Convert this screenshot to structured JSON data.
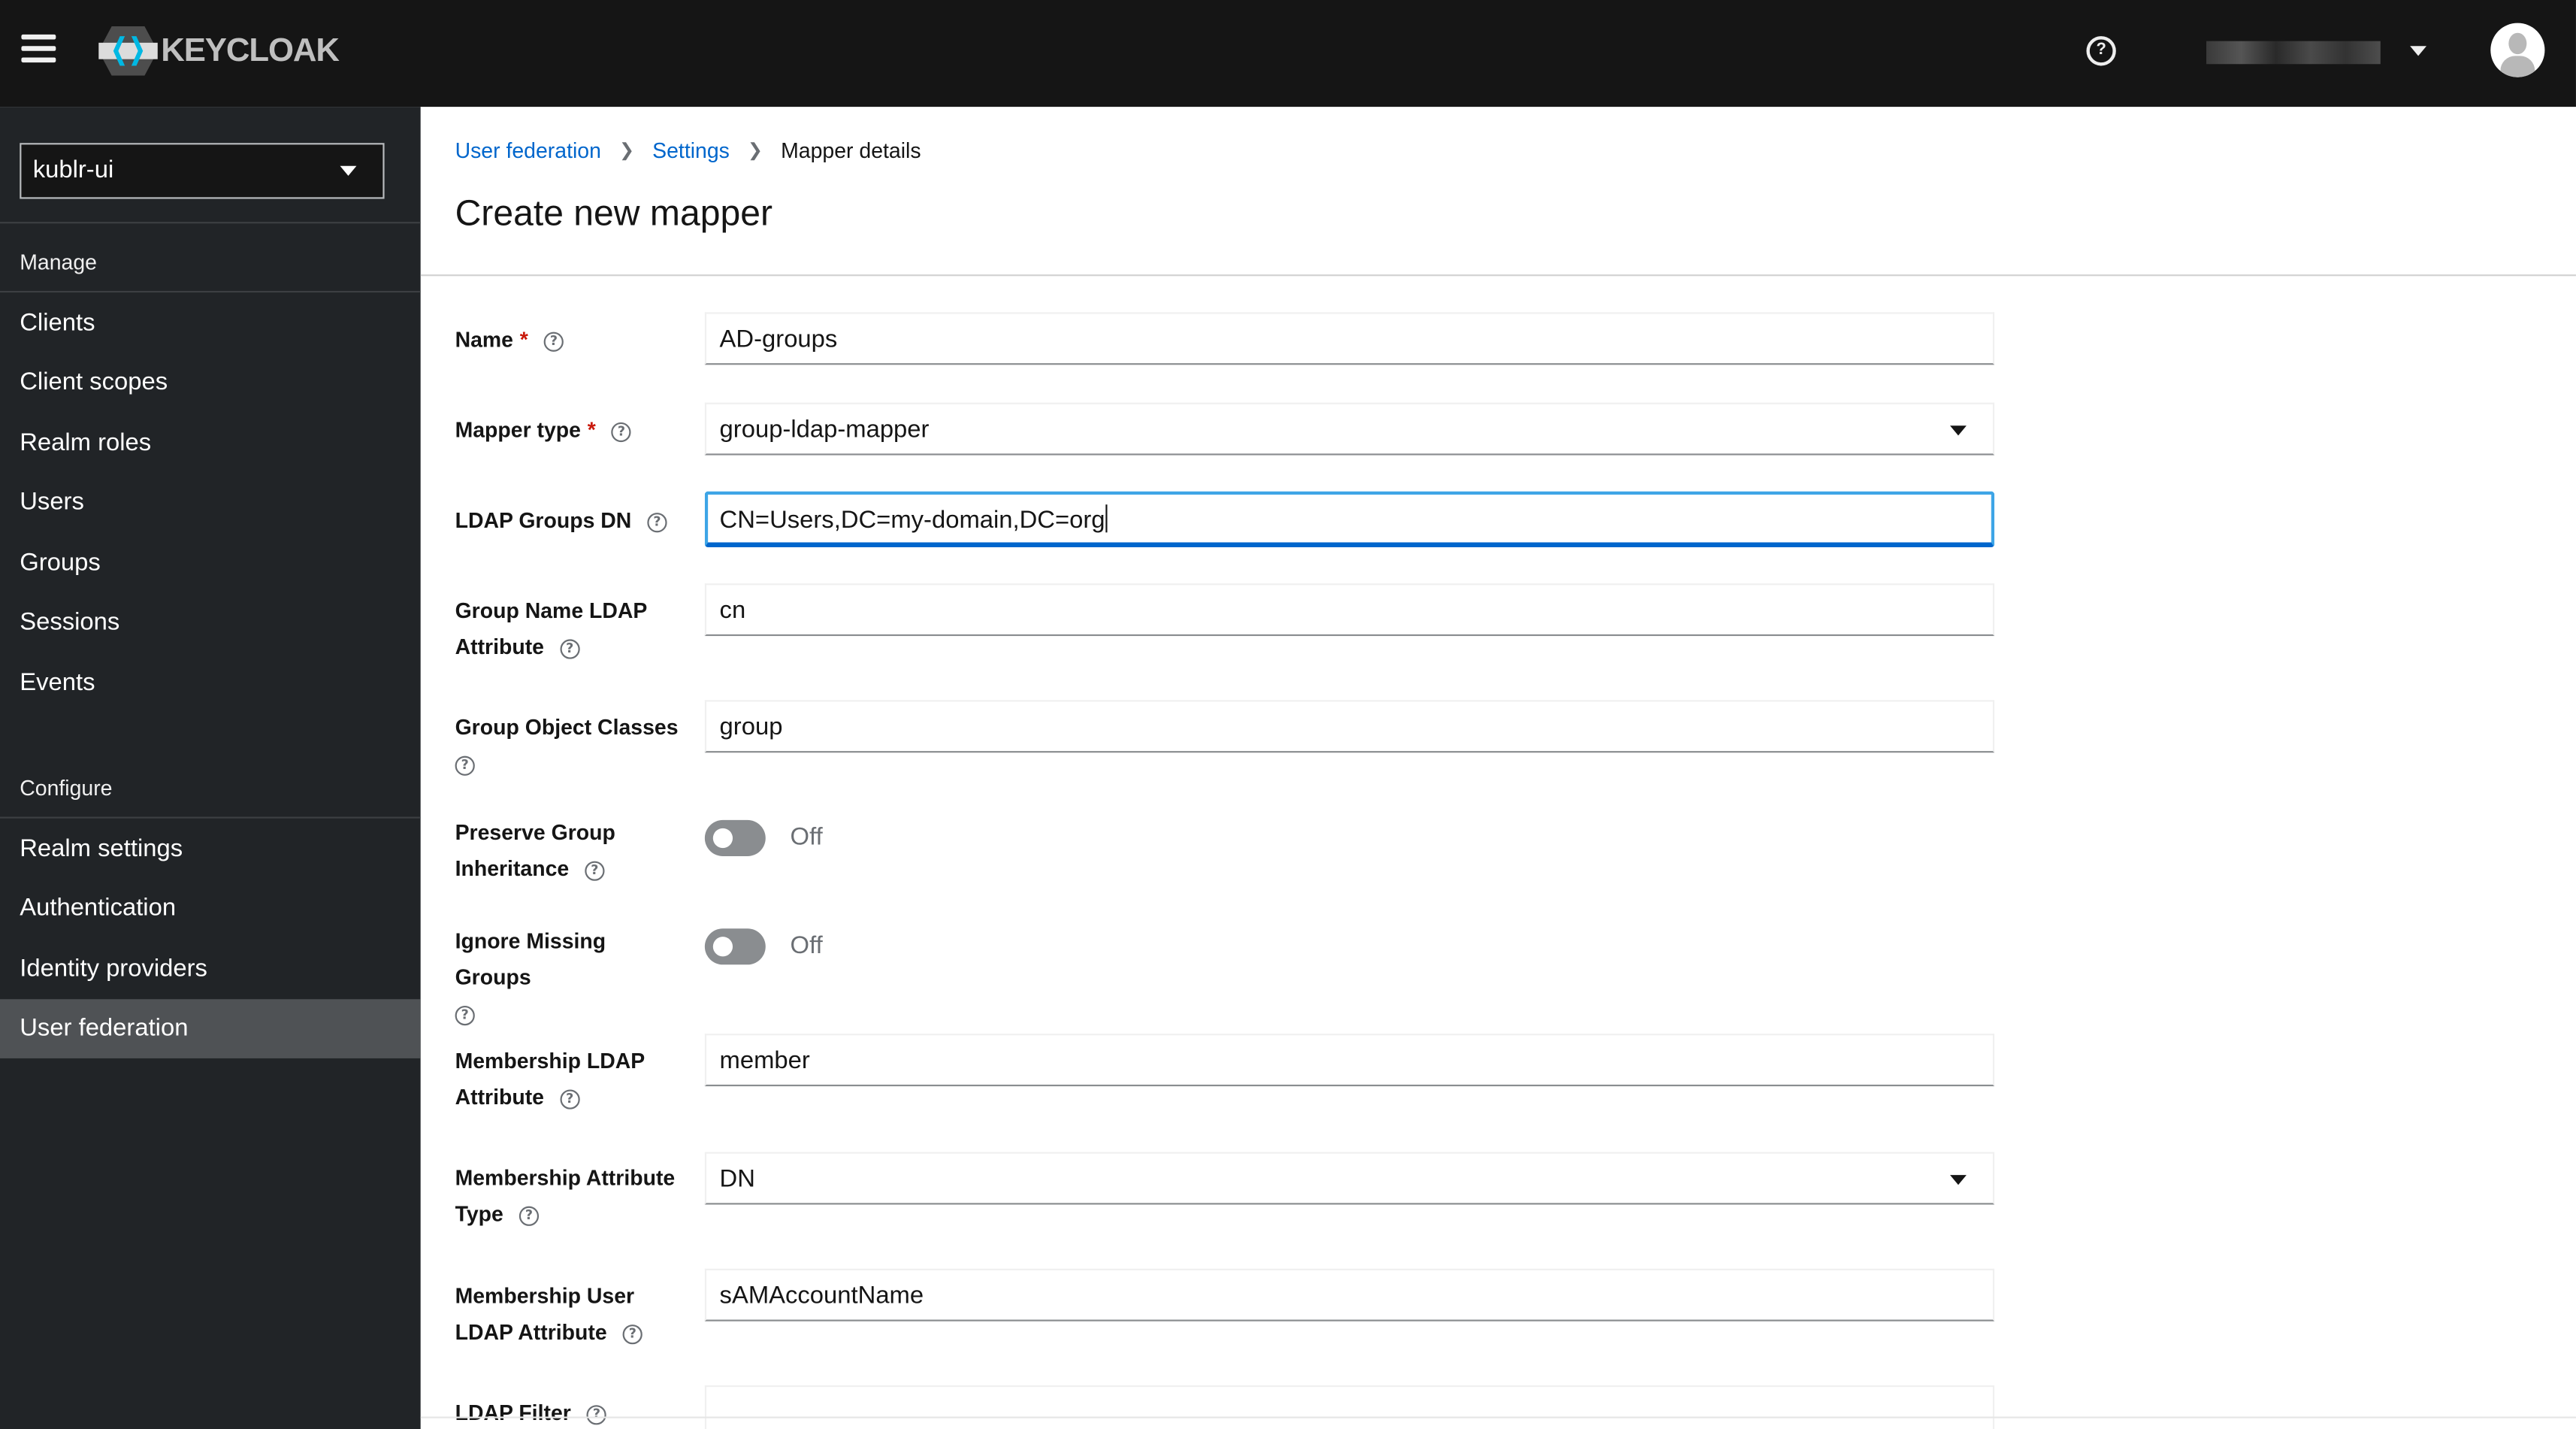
{
  "header": {
    "brand": "KEYCLOAK",
    "help_icon": "help-circle-icon",
    "user_name": "[redacted]",
    "avatar_icon": "user-avatar-icon"
  },
  "sidebar": {
    "realm": "kublr-ui",
    "sections": [
      {
        "title": "Manage",
        "items": [
          "Clients",
          "Client scopes",
          "Realm roles",
          "Users",
          "Groups",
          "Sessions",
          "Events"
        ]
      },
      {
        "title": "Configure",
        "items": [
          "Realm settings",
          "Authentication",
          "Identity providers",
          "User federation"
        ]
      }
    ],
    "active_item": "User federation"
  },
  "breadcrumb": [
    {
      "label": "User federation",
      "link": true
    },
    {
      "label": "Settings",
      "link": true
    },
    {
      "label": "Mapper details",
      "link": false
    }
  ],
  "page": {
    "title": "Create new mapper"
  },
  "colors": {
    "accent": "#0066cc",
    "focus": "#3ea5e6",
    "required": "#c9190b",
    "sidebar_bg": "#212427",
    "header_bg": "#151515"
  },
  "form": {
    "name": {
      "label": "Name",
      "required": true,
      "value": "AD-groups"
    },
    "mapper_type": {
      "label": "Mapper type",
      "required": true,
      "value": "group-ldap-mapper"
    },
    "ldap_groups_dn": {
      "label": "LDAP Groups DN",
      "value": "CN=Users,DC=my-domain,DC=org"
    },
    "group_name_attr": {
      "label_1": "Group Name LDAP",
      "label_2": "Attribute",
      "value": "cn"
    },
    "group_object_classes": {
      "label": "Group Object Classes",
      "value": "group"
    },
    "preserve_inheritance": {
      "label_1": "Preserve Group",
      "label_2": "Inheritance",
      "state": "Off"
    },
    "ignore_missing": {
      "label": "Ignore Missing Groups",
      "state": "Off"
    },
    "membership_attr": {
      "label_1": "Membership LDAP",
      "label_2": "Attribute",
      "value": "member"
    },
    "membership_attr_type": {
      "label_1": "Membership Attribute",
      "label_2": "Type",
      "value": "DN"
    },
    "membership_user_attr": {
      "label_1": "Membership User",
      "label_2": "LDAP Attribute",
      "value": "sAMAccountName"
    },
    "ldap_filter": {
      "label": "LDAP Filter",
      "value": ""
    }
  }
}
